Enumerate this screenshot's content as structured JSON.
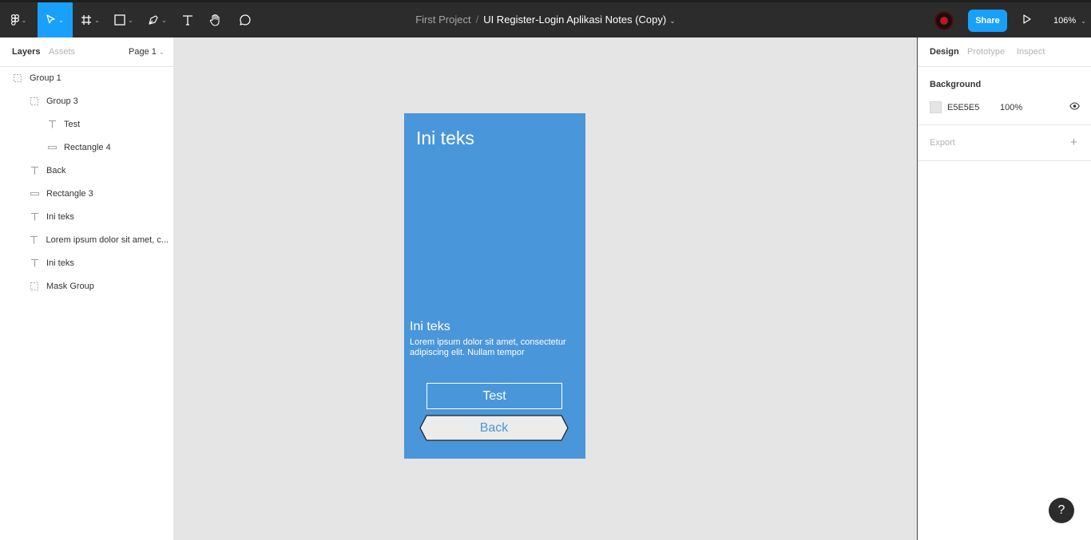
{
  "toolbar": {
    "project": "First Project",
    "separator": "/",
    "file_name": "UI Register-Login Aplikasi Notes (Copy)",
    "share_label": "Share",
    "zoom": "106%"
  },
  "left_panel": {
    "tab_layers": "Layers",
    "tab_assets": "Assets",
    "page": "Page 1",
    "layers": [
      {
        "name": "Group 1",
        "type": "group"
      },
      {
        "name": "Group 3",
        "type": "group"
      },
      {
        "name": "Test",
        "type": "text"
      },
      {
        "name": "Rectangle 4",
        "type": "rect"
      },
      {
        "name": "Back",
        "type": "text"
      },
      {
        "name": "Rectangle 3",
        "type": "rect"
      },
      {
        "name": "Ini teks",
        "type": "text"
      },
      {
        "name": "Lorem ipsum dolor sit amet, c...",
        "type": "text"
      },
      {
        "name": "Ini teks",
        "type": "text"
      },
      {
        "name": "Mask Group",
        "type": "group"
      }
    ]
  },
  "right_panel": {
    "tab_design": "Design",
    "tab_prototype": "Prototype",
    "tab_inspect": "Inspect",
    "background_label": "Background",
    "bg_hex": "E5E5E5",
    "bg_opacity": "100%",
    "export_label": "Export"
  },
  "canvas": {
    "title": "Ini teks",
    "heading": "Ini teks",
    "body": "Lorem ipsum dolor sit amet, consectetur adipiscing elit. Nullam tempor",
    "test_label": "Test",
    "back_label": "Back"
  },
  "help": "?",
  "colors": {
    "accent": "#18a0fb",
    "frame": "#4a96db",
    "toolbar": "#2c2c2c",
    "canvas": "#e5e5e5"
  }
}
